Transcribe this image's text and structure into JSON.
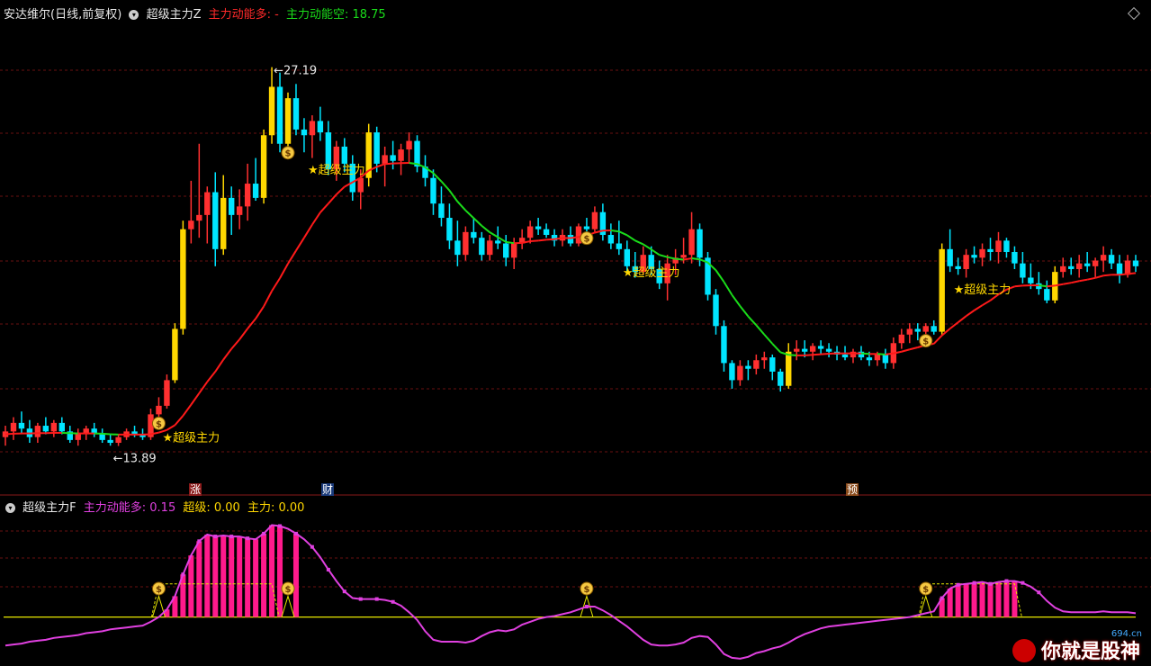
{
  "header": {
    "stock_title": "安达维尔(日线,前复权)",
    "indicator_main_name": "超级主力Z",
    "main_long_label": "主力动能多: -",
    "main_short_label": "主力动能空: 18.75"
  },
  "sub_header": {
    "indicator_name": "超级主力F",
    "long_label": "主力动能多: 0.15",
    "super_label": "超级: 0.00",
    "main_label": "主力: 0.00"
  },
  "annotations": {
    "high_label": "27.19",
    "low_label": "13.89",
    "signal_label": "★超级主力"
  },
  "event_markers": [
    "涨",
    "财",
    "预"
  ],
  "watermark": {
    "text": "你就是股神",
    "site": "694.cn"
  },
  "colors": {
    "up": "#ff3030",
    "up_strong": "#ffd700",
    "down": "#00e5ff",
    "ma_up": "#ff1a1a",
    "ma_down": "#1adc1a",
    "sub_line": "#e040e0",
    "sub_bar": "#ff1a8c",
    "baseline": "#e8e800",
    "grid": "#6a1010",
    "signal_text": "#ffd700"
  },
  "chart_data": [
    {
      "type": "candlestick",
      "title": "安达维尔(日线,前复权)",
      "ylim": [
        12.8,
        28.6
      ],
      "high": 27.19,
      "low": 13.89,
      "ohlc": [
        [
          14.2,
          14.6,
          13.9,
          14.4
        ],
        [
          14.4,
          14.9,
          14.1,
          14.7
        ],
        [
          14.7,
          15.1,
          14.3,
          14.5
        ],
        [
          14.5,
          14.8,
          14.0,
          14.2
        ],
        [
          14.2,
          14.7,
          14.0,
          14.6
        ],
        [
          14.6,
          14.9,
          14.3,
          14.4
        ],
        [
          14.4,
          14.8,
          14.2,
          14.7
        ],
        [
          14.7,
          14.9,
          14.3,
          14.4
        ],
        [
          14.4,
          14.6,
          14.0,
          14.1
        ],
        [
          14.1,
          14.5,
          13.9,
          14.3
        ],
        [
          14.3,
          14.6,
          14.1,
          14.5
        ],
        [
          14.5,
          14.7,
          14.2,
          14.3
        ],
        [
          14.3,
          14.5,
          14.0,
          14.1
        ],
        [
          14.1,
          14.3,
          13.9,
          14.0
        ],
        [
          14.0,
          14.3,
          13.89,
          14.2
        ],
        [
          14.2,
          14.5,
          14.1,
          14.4
        ],
        [
          14.4,
          14.6,
          14.2,
          14.3
        ],
        [
          14.3,
          14.5,
          14.1,
          14.2
        ],
        [
          14.2,
          15.2,
          14.1,
          15.0
        ],
        [
          15.0,
          15.6,
          14.8,
          15.3
        ],
        [
          15.3,
          16.4,
          15.2,
          16.2
        ],
        [
          16.2,
          18.2,
          16.1,
          18.0
        ],
        [
          18.0,
          21.8,
          17.8,
          21.5
        ],
        [
          21.5,
          23.2,
          21.0,
          21.8
        ],
        [
          21.8,
          24.5,
          21.2,
          22.0
        ],
        [
          22.0,
          23.0,
          21.0,
          22.8
        ],
        [
          22.8,
          23.5,
          20.2,
          20.8
        ],
        [
          20.8,
          23.4,
          20.6,
          22.6
        ],
        [
          22.6,
          23.0,
          21.3,
          22.0
        ],
        [
          22.0,
          22.9,
          21.5,
          22.3
        ],
        [
          22.3,
          23.8,
          21.8,
          23.1
        ],
        [
          23.1,
          24.0,
          22.5,
          22.6
        ],
        [
          22.6,
          25.0,
          22.4,
          24.8
        ],
        [
          24.8,
          27.19,
          24.5,
          26.5
        ],
        [
          26.5,
          27.0,
          24.2,
          24.5
        ],
        [
          24.5,
          26.3,
          24.2,
          26.1
        ],
        [
          26.1,
          26.6,
          24.8,
          25.0
        ],
        [
          25.0,
          25.4,
          24.2,
          24.8
        ],
        [
          24.8,
          25.5,
          24.0,
          25.3
        ],
        [
          25.3,
          25.8,
          24.6,
          24.9
        ],
        [
          24.9,
          25.3,
          23.4,
          23.6
        ],
        [
          23.6,
          24.6,
          23.2,
          24.4
        ],
        [
          24.4,
          24.7,
          23.5,
          23.8
        ],
        [
          23.8,
          24.1,
          22.5,
          22.8
        ],
        [
          22.8,
          23.6,
          22.2,
          23.3
        ],
        [
          23.3,
          25.2,
          23.0,
          24.9
        ],
        [
          24.9,
          25.1,
          23.5,
          23.8
        ],
        [
          23.8,
          24.4,
          23.0,
          24.1
        ],
        [
          24.1,
          24.6,
          23.6,
          23.9
        ],
        [
          23.9,
          24.5,
          23.4,
          24.3
        ],
        [
          24.3,
          24.9,
          23.8,
          24.6
        ],
        [
          24.6,
          24.8,
          23.5,
          23.7
        ],
        [
          23.7,
          24.1,
          23.0,
          23.3
        ],
        [
          23.3,
          23.6,
          22.0,
          22.4
        ],
        [
          22.4,
          23.0,
          21.6,
          21.9
        ],
        [
          21.9,
          22.4,
          20.8,
          21.1
        ],
        [
          21.1,
          21.8,
          20.2,
          20.6
        ],
        [
          20.6,
          21.6,
          20.4,
          21.4
        ],
        [
          21.4,
          21.9,
          21.0,
          21.2
        ],
        [
          21.2,
          21.4,
          20.4,
          20.6
        ],
        [
          20.6,
          21.3,
          20.4,
          21.1
        ],
        [
          21.1,
          21.6,
          20.8,
          21.0
        ],
        [
          21.0,
          21.3,
          20.2,
          20.5
        ],
        [
          20.5,
          21.2,
          20.1,
          21.0
        ],
        [
          21.0,
          21.5,
          20.8,
          21.2
        ],
        [
          21.2,
          21.8,
          21.0,
          21.6
        ],
        [
          21.6,
          21.9,
          21.3,
          21.5
        ],
        [
          21.5,
          21.7,
          21.2,
          21.3
        ],
        [
          21.3,
          21.5,
          20.9,
          21.1
        ],
        [
          21.1,
          21.5,
          20.9,
          21.3
        ],
        [
          21.3,
          21.6,
          20.9,
          21.0
        ],
        [
          21.0,
          21.7,
          20.9,
          21.6
        ],
        [
          21.6,
          21.9,
          21.3,
          21.5
        ],
        [
          21.5,
          22.3,
          21.4,
          22.1
        ],
        [
          22.1,
          22.4,
          21.1,
          21.3
        ],
        [
          21.3,
          21.7,
          20.8,
          21.0
        ],
        [
          21.0,
          21.8,
          20.6,
          20.8
        ],
        [
          20.8,
          21.1,
          20.0,
          20.2
        ],
        [
          20.2,
          20.7,
          19.8,
          20.0
        ],
        [
          20.0,
          20.9,
          19.9,
          20.6
        ],
        [
          20.6,
          20.9,
          19.9,
          20.1
        ],
        [
          20.1,
          20.4,
          19.4,
          19.6
        ],
        [
          19.6,
          20.6,
          19.0,
          20.3
        ],
        [
          20.3,
          20.8,
          19.9,
          20.5
        ],
        [
          20.5,
          21.2,
          20.3,
          20.6
        ],
        [
          20.6,
          22.1,
          20.3,
          21.5
        ],
        [
          21.5,
          21.7,
          20.2,
          20.5
        ],
        [
          20.5,
          20.7,
          19.0,
          19.2
        ],
        [
          19.2,
          19.4,
          17.8,
          18.1
        ],
        [
          18.1,
          18.3,
          16.5,
          16.8
        ],
        [
          16.8,
          16.9,
          15.9,
          16.2
        ],
        [
          16.2,
          16.9,
          16.0,
          16.7
        ],
        [
          16.7,
          16.9,
          16.2,
          16.6
        ],
        [
          16.6,
          17.1,
          16.4,
          16.9
        ],
        [
          16.9,
          17.2,
          16.6,
          17.0
        ],
        [
          17.0,
          17.1,
          16.2,
          16.5
        ],
        [
          16.5,
          16.6,
          15.8,
          16.0
        ],
        [
          16.0,
          17.5,
          15.9,
          17.2
        ],
        [
          17.2,
          17.6,
          16.9,
          17.3
        ],
        [
          17.3,
          17.6,
          17.0,
          17.2
        ],
        [
          17.2,
          17.5,
          16.9,
          17.4
        ],
        [
          17.4,
          17.6,
          17.1,
          17.3
        ],
        [
          17.3,
          17.5,
          17.0,
          17.2
        ],
        [
          17.2,
          17.4,
          16.9,
          17.1
        ],
        [
          17.1,
          17.4,
          16.9,
          17.0
        ],
        [
          17.0,
          17.3,
          16.8,
          17.2
        ],
        [
          17.2,
          17.4,
          16.9,
          17.0
        ],
        [
          17.0,
          17.2,
          16.7,
          16.9
        ],
        [
          16.9,
          17.2,
          16.7,
          17.1
        ],
        [
          17.1,
          17.3,
          16.6,
          16.8
        ],
        [
          16.8,
          17.7,
          16.6,
          17.5
        ],
        [
          17.5,
          18.0,
          17.3,
          17.8
        ],
        [
          17.8,
          18.2,
          17.5,
          18.0
        ],
        [
          18.0,
          18.2,
          17.6,
          17.9
        ],
        [
          17.9,
          18.2,
          17.7,
          18.1
        ],
        [
          18.1,
          18.3,
          17.8,
          17.9
        ],
        [
          17.9,
          21.0,
          17.8,
          20.8
        ],
        [
          20.8,
          21.5,
          20.0,
          20.2
        ],
        [
          20.2,
          20.5,
          19.9,
          20.1
        ],
        [
          20.1,
          20.8,
          19.8,
          20.6
        ],
        [
          20.6,
          20.9,
          20.3,
          20.5
        ],
        [
          20.5,
          21.0,
          20.2,
          20.8
        ],
        [
          20.8,
          21.2,
          20.4,
          20.7
        ],
        [
          20.7,
          21.4,
          20.3,
          21.1
        ],
        [
          21.1,
          21.2,
          20.5,
          20.7
        ],
        [
          20.7,
          20.9,
          20.1,
          20.3
        ],
        [
          20.3,
          20.7,
          19.6,
          19.8
        ],
        [
          19.8,
          20.3,
          19.4,
          19.6
        ],
        [
          19.6,
          20.0,
          19.2,
          19.4
        ],
        [
          19.4,
          19.7,
          18.9,
          19.0
        ],
        [
          19.0,
          20.2,
          18.9,
          20.0
        ],
        [
          20.0,
          20.5,
          19.8,
          20.2
        ],
        [
          20.2,
          20.5,
          19.9,
          20.1
        ],
        [
          20.1,
          20.6,
          19.8,
          20.3
        ],
        [
          20.3,
          20.7,
          20.0,
          20.2
        ],
        [
          20.2,
          20.5,
          19.8,
          20.4
        ],
        [
          20.4,
          20.9,
          20.0,
          20.6
        ],
        [
          20.6,
          20.8,
          20.1,
          20.3
        ],
        [
          20.3,
          20.6,
          19.6,
          19.9
        ],
        [
          19.9,
          20.6,
          19.8,
          20.4
        ],
        [
          20.4,
          20.6,
          20.0,
          20.2
        ]
      ],
      "ma": [
        14.3,
        14.32,
        14.33,
        14.33,
        14.34,
        14.34,
        14.35,
        14.35,
        14.34,
        14.33,
        14.33,
        14.33,
        14.32,
        14.3,
        14.29,
        14.29,
        14.29,
        14.29,
        14.3,
        14.36,
        14.45,
        14.62,
        14.95,
        15.34,
        15.74,
        16.14,
        16.5,
        16.92,
        17.3,
        17.63,
        18.01,
        18.36,
        18.79,
        19.33,
        19.78,
        20.29,
        20.75,
        21.2,
        21.66,
        22.09,
        22.4,
        22.72,
        22.99,
        23.15,
        23.31,
        23.56,
        23.69,
        23.79,
        23.81,
        23.82,
        23.83,
        23.79,
        23.67,
        23.47,
        23.18,
        22.86,
        22.47,
        22.16,
        21.89,
        21.62,
        21.39,
        21.22,
        21.05,
        21.01,
        21.02,
        21.08,
        21.1,
        21.13,
        21.15,
        21.19,
        21.19,
        21.23,
        21.28,
        21.38,
        21.45,
        21.46,
        21.42,
        21.29,
        21.1,
        20.97,
        20.79,
        20.6,
        20.52,
        20.46,
        20.43,
        20.48,
        20.44,
        20.33,
        20.06,
        19.65,
        19.19,
        18.8,
        18.44,
        18.13,
        17.8,
        17.48,
        17.18,
        17.09,
        17.07,
        17.07,
        17.09,
        17.11,
        17.13,
        17.14,
        17.14,
        17.14,
        17.14,
        17.12,
        17.12,
        17.1,
        17.14,
        17.2,
        17.28,
        17.35,
        17.43,
        17.48,
        17.77,
        18.01,
        18.23,
        18.45,
        18.65,
        18.83,
        19.0,
        19.21,
        19.38,
        19.49,
        19.52,
        19.53,
        19.53,
        19.49,
        19.52,
        19.57,
        19.62,
        19.68,
        19.73,
        19.79,
        19.87,
        19.9,
        19.9,
        19.93,
        19.96
      ],
      "signals": [
        19,
        35,
        72,
        114
      ],
      "stars": [
        19,
        37,
        76,
        117
      ]
    },
    {
      "type": "bar+line",
      "title": "超级主力F",
      "ylim": [
        -0.45,
        1.05
      ],
      "baseline": 0,
      "dashed_level": 0.35,
      "line": [
        -0.3,
        -0.29,
        -0.28,
        -0.26,
        -0.25,
        -0.24,
        -0.22,
        -0.21,
        -0.2,
        -0.19,
        -0.17,
        -0.16,
        -0.15,
        -0.13,
        -0.12,
        -0.11,
        -0.1,
        -0.09,
        -0.05,
        0.0,
        0.08,
        0.22,
        0.45,
        0.65,
        0.8,
        0.87,
        0.85,
        0.86,
        0.85,
        0.85,
        0.83,
        0.82,
        0.88,
        0.97,
        0.96,
        0.93,
        0.88,
        0.82,
        0.74,
        0.63,
        0.5,
        0.38,
        0.27,
        0.2,
        0.19,
        0.19,
        0.19,
        0.18,
        0.16,
        0.12,
        0.05,
        -0.03,
        -0.15,
        -0.24,
        -0.26,
        -0.26,
        -0.26,
        -0.27,
        -0.25,
        -0.2,
        -0.16,
        -0.14,
        -0.15,
        -0.13,
        -0.08,
        -0.05,
        -0.02,
        0.0,
        0.01,
        0.03,
        0.05,
        0.08,
        0.11,
        0.11,
        0.07,
        0.02,
        -0.04,
        -0.1,
        -0.17,
        -0.24,
        -0.29,
        -0.3,
        -0.3,
        -0.29,
        -0.27,
        -0.22,
        -0.2,
        -0.21,
        -0.29,
        -0.39,
        -0.43,
        -0.44,
        -0.42,
        -0.38,
        -0.36,
        -0.33,
        -0.31,
        -0.27,
        -0.22,
        -0.18,
        -0.15,
        -0.12,
        -0.1,
        -0.09,
        -0.08,
        -0.07,
        -0.06,
        -0.05,
        -0.04,
        -0.03,
        -0.02,
        -0.01,
        0.0,
        0.02,
        0.04,
        0.06,
        0.2,
        0.3,
        0.34,
        0.35,
        0.36,
        0.37,
        0.35,
        0.37,
        0.38,
        0.38,
        0.36,
        0.32,
        0.26,
        0.17,
        0.1,
        0.06,
        0.05,
        0.05,
        0.05,
        0.05,
        0.06,
        0.05,
        0.05,
        0.05,
        0.04
      ],
      "bars": [
        0,
        0,
        0,
        0,
        0,
        0,
        0,
        0,
        0,
        0,
        0,
        0,
        0,
        0,
        0,
        0,
        0,
        0,
        0,
        0,
        0.08,
        0.22,
        0.45,
        0.65,
        0.8,
        0.87,
        0.85,
        0.86,
        0.85,
        0.85,
        0.83,
        0.82,
        0.88,
        0.97,
        0.96,
        0,
        0.88,
        0,
        0,
        0,
        0,
        0,
        0,
        0,
        0,
        0,
        0,
        0,
        0,
        0,
        0,
        0,
        0,
        0,
        0,
        0,
        0,
        0,
        0,
        0,
        0,
        0,
        0,
        0,
        0,
        0,
        0,
        0,
        0,
        0,
        0,
        0,
        0,
        0,
        0,
        0,
        0,
        0,
        0,
        0,
        0,
        0,
        0,
        0,
        0,
        0,
        0,
        0,
        0,
        0,
        0,
        0,
        0,
        0,
        0,
        0,
        0,
        0,
        0,
        0,
        0,
        0,
        0,
        0,
        0,
        0,
        0,
        0,
        0,
        0,
        0,
        0,
        0,
        0,
        0,
        0,
        0.2,
        0.3,
        0.34,
        0.35,
        0.36,
        0.37,
        0.35,
        0.37,
        0.38,
        0.38,
        0,
        0,
        0,
        0,
        0,
        0,
        0,
        0,
        0,
        0,
        0,
        0,
        0,
        0,
        0
      ],
      "signals": [
        19,
        35,
        72,
        114
      ],
      "dashed_ranges": [
        [
          19,
          33
        ],
        [
          114,
          125
        ]
      ]
    }
  ]
}
